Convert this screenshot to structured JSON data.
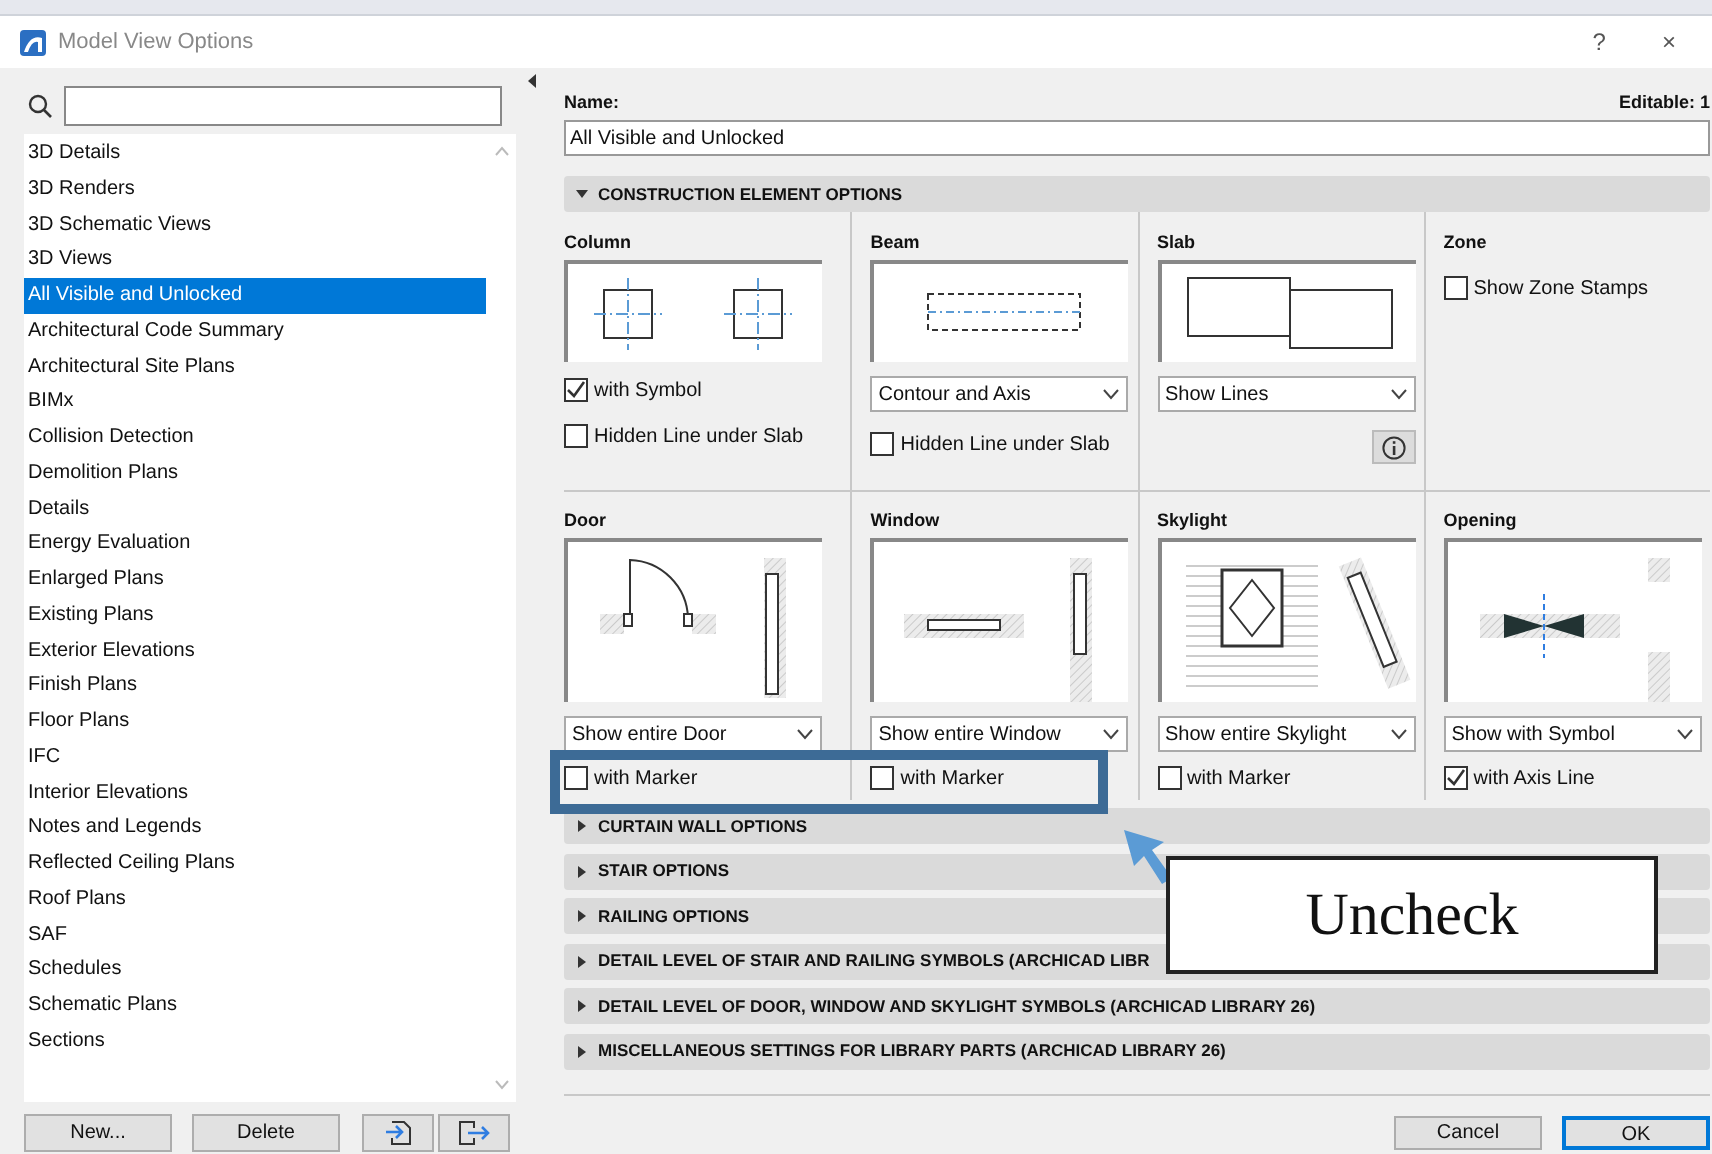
{
  "window": {
    "title": "Model View Options",
    "buttons": [
      "?",
      "×"
    ]
  },
  "sidebar": {
    "items": [
      {
        "label": "3D Details",
        "selected": false
      },
      {
        "label": "3D Renders",
        "selected": false
      },
      {
        "label": "3D Schematic Views",
        "selected": false
      },
      {
        "label": "3D Views",
        "selected": false
      },
      {
        "label": "All Visible and Unlocked",
        "selected": true
      },
      {
        "label": "Architectural Code Summary",
        "selected": false
      },
      {
        "label": "Architectural Site Plans",
        "selected": false
      },
      {
        "label": "BIMx",
        "selected": false
      },
      {
        "label": "Collision Detection",
        "selected": false
      },
      {
        "label": "Demolition Plans",
        "selected": false
      },
      {
        "label": "Details",
        "selected": false
      },
      {
        "label": "Energy Evaluation",
        "selected": false
      },
      {
        "label": "Enlarged Plans",
        "selected": false
      },
      {
        "label": "Existing Plans",
        "selected": false
      },
      {
        "label": "Exterior Elevations",
        "selected": false
      },
      {
        "label": "Finish Plans",
        "selected": false
      },
      {
        "label": "Floor Plans",
        "selected": false
      },
      {
        "label": "IFC",
        "selected": false
      },
      {
        "label": "Interior Elevations",
        "selected": false
      },
      {
        "label": "Notes and Legends",
        "selected": false
      },
      {
        "label": "Reflected Ceiling Plans",
        "selected": false
      },
      {
        "label": "Roof Plans",
        "selected": false
      },
      {
        "label": "SAF",
        "selected": false
      },
      {
        "label": "Schedules",
        "selected": false
      },
      {
        "label": "Schematic Plans",
        "selected": false
      },
      {
        "label": "Sections",
        "selected": false
      }
    ],
    "buttons": [
      "New...",
      "Delete"
    ]
  },
  "form": {
    "name_label": "Name:",
    "editable": "Editable: 1",
    "name_value": "All Visible and Unlocked",
    "sections": [
      {
        "title": "CONSTRUCTION ELEMENT OPTIONS",
        "expanded": true
      },
      {
        "title": "CURTAIN WALL OPTIONS",
        "expanded": false
      },
      {
        "title": "STAIR OPTIONS",
        "expanded": false
      },
      {
        "title": "RAILING OPTIONS",
        "expanded": false
      },
      {
        "title": "DETAIL LEVEL OF STAIR AND RAILING SYMBOLS (ARCHICAD LIBR",
        "expanded": false
      },
      {
        "title": "DETAIL LEVEL OF DOOR, WINDOW AND SKYLIGHT SYMBOLS (ARCHICAD LIBRARY 26)",
        "expanded": false
      },
      {
        "title": "MISCELLANEOUS SETTINGS FOR LIBRARY PARTS (ARCHICAD LIBRARY 26)",
        "expanded": false
      }
    ],
    "panels": [
      {
        "title": "Column",
        "kind": "column",
        "controls": [
          {
            "kind": "checkbox",
            "label": "with Symbol",
            "checked": true
          },
          {
            "kind": "checkbox",
            "label": "Hidden Line under Slab",
            "checked": false
          }
        ]
      },
      {
        "title": "Beam",
        "kind": "beam",
        "controls": [
          {
            "kind": "select",
            "value": "Contour and Axis"
          },
          {
            "kind": "checkbox",
            "label": "Hidden Line under Slab",
            "checked": false
          }
        ]
      },
      {
        "title": "Slab",
        "kind": "slab",
        "controls": [
          {
            "kind": "select",
            "value": "Show Lines"
          },
          {
            "kind": "info"
          }
        ]
      },
      {
        "title": "Zone",
        "kind": "zone",
        "controls": [
          {
            "kind": "checkbox",
            "label": "Show Zone Stamps",
            "checked": false
          }
        ]
      },
      {
        "title": "Door",
        "kind": "door",
        "controls": [
          {
            "kind": "select",
            "value": "Show entire Door"
          },
          {
            "kind": "checkbox",
            "label": "with Marker",
            "checked": false
          }
        ]
      },
      {
        "title": "Window",
        "kind": "window",
        "controls": [
          {
            "kind": "select",
            "value": "Show entire Window"
          },
          {
            "kind": "checkbox",
            "label": "with Marker",
            "checked": false
          }
        ]
      },
      {
        "title": "Skylight",
        "kind": "skylight",
        "controls": [
          {
            "kind": "select",
            "value": "Show entire Skylight"
          },
          {
            "kind": "checkbox",
            "label": "with Marker",
            "checked": false
          }
        ]
      },
      {
        "title": "Opening",
        "kind": "opening",
        "controls": [
          {
            "kind": "select",
            "value": "Show with Symbol"
          },
          {
            "kind": "checkbox",
            "label": "with Axis Line",
            "checked": true
          }
        ]
      }
    ],
    "buttons": [
      {
        "label": "Cancel",
        "default": false
      },
      {
        "label": "OK",
        "default": true
      }
    ]
  },
  "annotation": {
    "label": "Uncheck"
  }
}
